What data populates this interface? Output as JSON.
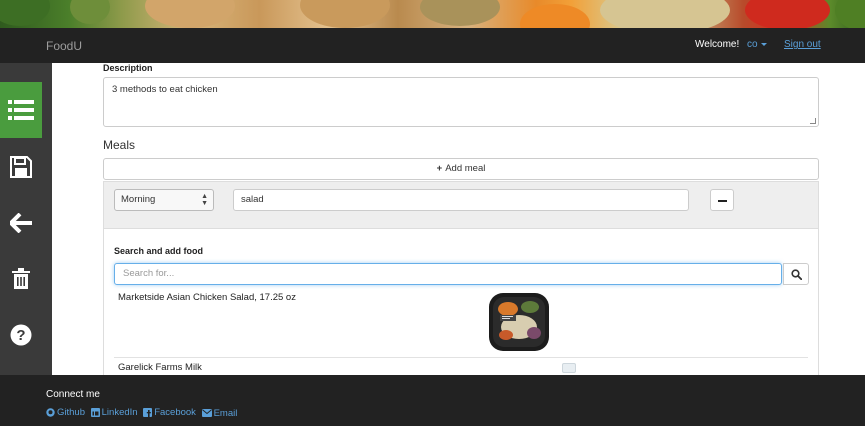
{
  "header": {
    "brand": "FoodU",
    "welcome": "Welcome!",
    "username": "co",
    "signout": "Sign out"
  },
  "sidebar": {
    "items": [
      {
        "icon": "list-icon",
        "active": true
      },
      {
        "icon": "save-icon",
        "active": false
      },
      {
        "icon": "arrow-left-icon",
        "active": false
      },
      {
        "icon": "trash-icon",
        "active": false
      },
      {
        "icon": "question-circle-icon",
        "active": false
      }
    ]
  },
  "form": {
    "description_label": "Description",
    "description_value": "3 methods to eat chicken",
    "meals_title": "Meals",
    "add_meal_label": "Add meal"
  },
  "meal": {
    "time_selected": "Morning",
    "name_value": "salad"
  },
  "search": {
    "title": "Search and add food",
    "placeholder": "Search for...",
    "results": [
      {
        "name": "Marketside Asian Chicken Salad, 17.25 oz"
      },
      {
        "name": "Garelick Farms Milk"
      }
    ]
  },
  "footer": {
    "connect": "Connect me",
    "links": [
      "Github",
      "LinkedIn",
      "Facebook",
      "Email"
    ]
  },
  "colors": {
    "accent": "#4a9c3e",
    "link": "#5a9fd8",
    "navbar": "#222222",
    "sidebar": "#3a3a3a"
  }
}
